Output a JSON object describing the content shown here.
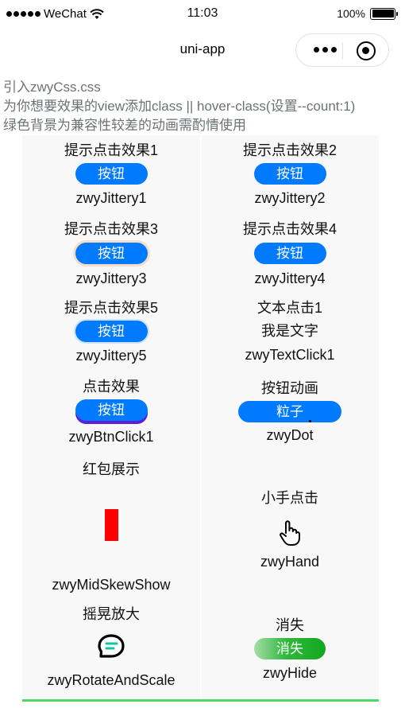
{
  "status_bar": {
    "carrier": "WeChat",
    "time": "11:03",
    "battery": "100%"
  },
  "nav": {
    "title": "uni-app"
  },
  "intro": {
    "line1": "引入zwyCss.css",
    "line2": "为你想要效果的view添加class || hover-class(设置--count:1)",
    "line3": "绿色背景为兼容性较差的动画需酌情使用"
  },
  "items": [
    {
      "title": "提示点击效果1",
      "button": "按钮",
      "name": "zwyJittery1"
    },
    {
      "title": "提示点击效果2",
      "button": "按钮",
      "name": "zwyJittery2"
    },
    {
      "title": "提示点击效果3",
      "button": "按钮",
      "name": "zwyJittery3"
    },
    {
      "title": "提示点击效果4",
      "button": "按钮",
      "name": "zwyJittery4"
    },
    {
      "title": "提示点击效果5",
      "button": "按钮",
      "name": "zwyJittery5"
    },
    {
      "title": "文本点击1",
      "text": "我是文字",
      "name": "zwyTextClick1"
    },
    {
      "title": "点击效果",
      "button": "按钮",
      "name": "zwyBtnClick1"
    },
    {
      "title": "按钮动画",
      "button": "粒子",
      "name": "zwyDot"
    },
    {
      "title": "红包展示",
      "name": "zwyMidSkewShow"
    },
    {
      "title": "小手点击",
      "name": "zwyHand"
    },
    {
      "title": "摇晃放大",
      "name": "zwyRotateAndScale"
    },
    {
      "title": "消失",
      "button": "消失",
      "name": "zwyHide"
    }
  ],
  "colors": {
    "primary_button": "#007aff",
    "red_packet": "#ff0000",
    "bottom_accent": "#4cd964"
  }
}
